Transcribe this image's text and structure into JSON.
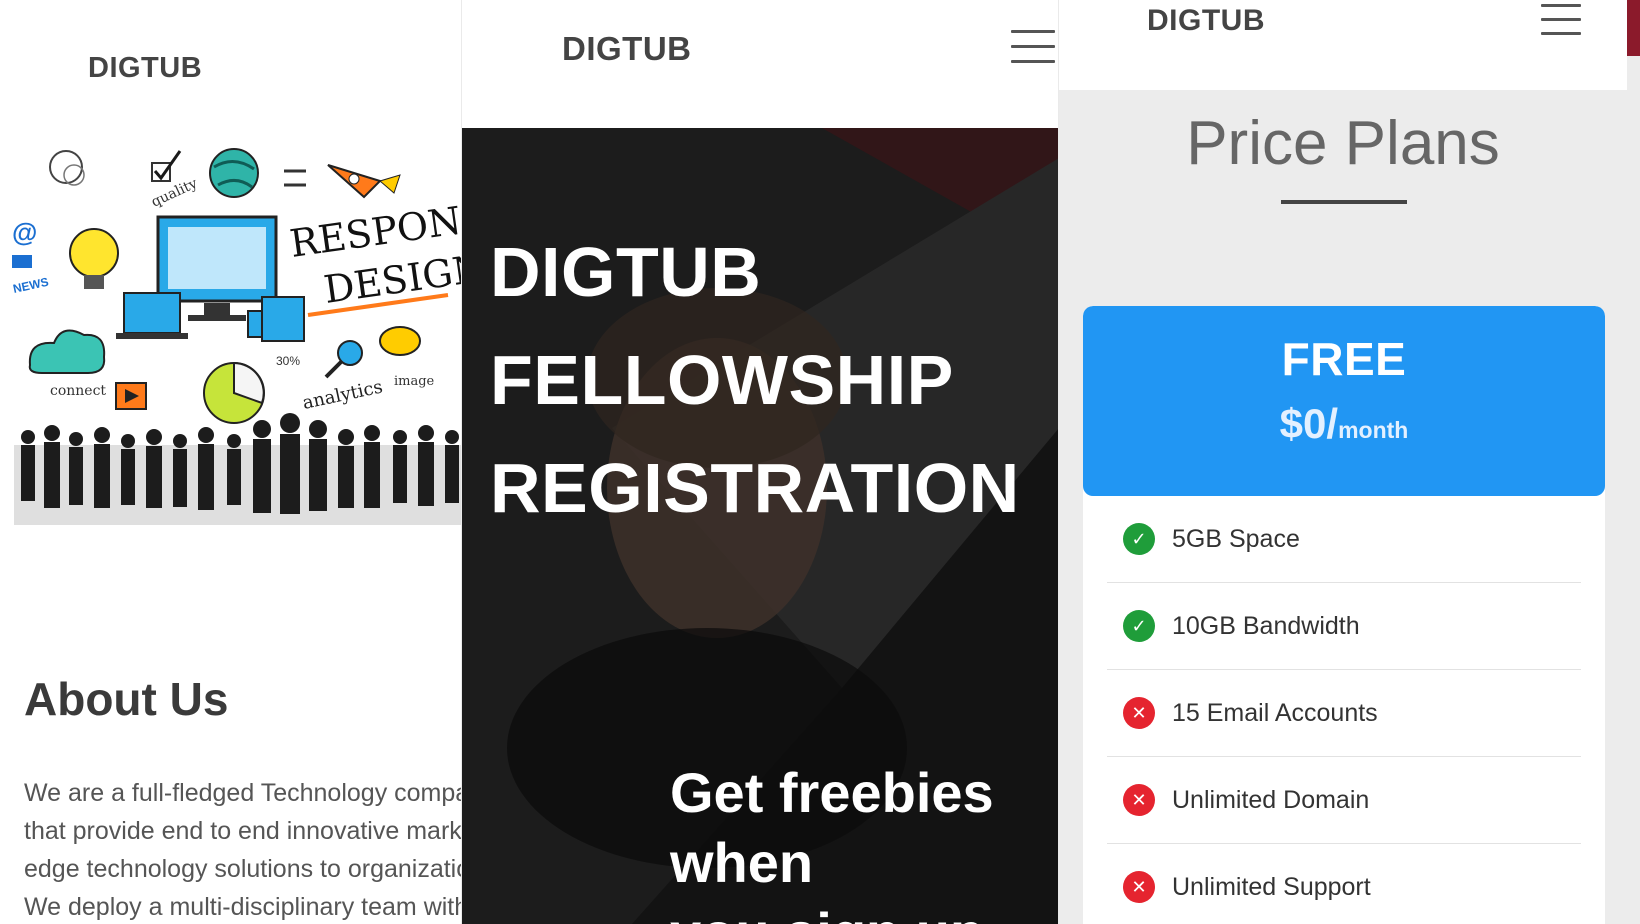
{
  "panel1": {
    "brand": "DIGTUB",
    "illustration": {
      "responsive_line1": "RESPONSIVE",
      "responsive_line2": "DESIGN",
      "quality": "quality",
      "news": "NEWS",
      "connect": "connect",
      "analytics": "analytics",
      "image": "image",
      "percent": "30%"
    },
    "about_title": "About Us",
    "about_lines": [
      "We are a full-fledged Technology company",
      "that provide end to end innovative marketing",
      "edge technology solutions to organizations.",
      "We deploy a multi-disciplinary team with"
    ]
  },
  "panel2": {
    "brand": "DIGTUB",
    "hero_lines": [
      "DIGTUB",
      "FELLOWSHIP",
      "REGISTRATION"
    ],
    "sub_lines": [
      "Get freebies",
      "when",
      "you sign up"
    ]
  },
  "panel3": {
    "brand": "DIGTUB",
    "section_title": "Price Plans",
    "plan": {
      "name": "FREE",
      "price": "$0/",
      "unit": "month",
      "features": [
        {
          "label": "5GB Space",
          "included": true,
          "icon": "check-circle-icon"
        },
        {
          "label": "10GB Bandwidth",
          "included": true,
          "icon": "check-circle-icon"
        },
        {
          "label": "15 Email Accounts",
          "included": false,
          "icon": "x-circle-icon"
        },
        {
          "label": "Unlimited Domain",
          "included": false,
          "icon": "x-circle-icon"
        },
        {
          "label": "Unlimited Support",
          "included": false,
          "icon": "x-circle-icon"
        }
      ]
    }
  },
  "colors": {
    "accent_blue": "#2196f3",
    "check_green": "#1f9d3a",
    "cross_red": "#e5242f",
    "hero_dark": "#222222"
  }
}
